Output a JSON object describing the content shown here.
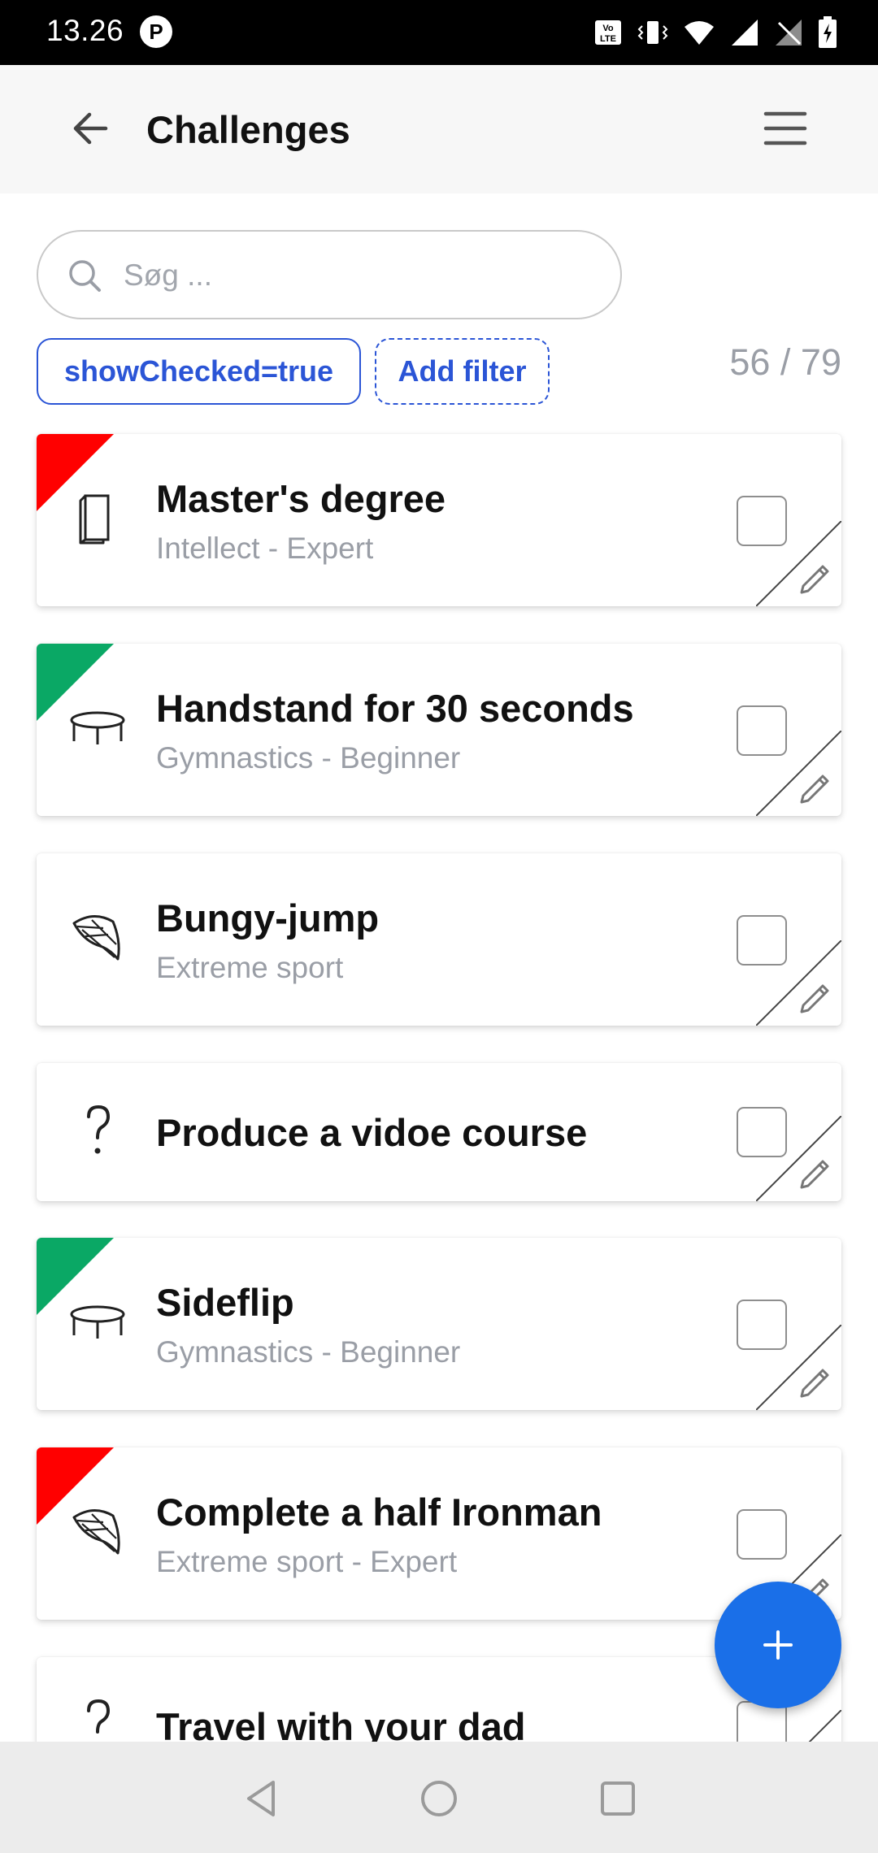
{
  "status_bar": {
    "time": "13.26",
    "app_indicator": "P",
    "icons": [
      "volte-icon",
      "vibrate-icon",
      "wifi-icon",
      "signal-icon",
      "no-signal-icon",
      "battery-charging-icon"
    ]
  },
  "app_bar": {
    "title": "Challenges",
    "back_icon": "arrow-left-icon",
    "menu_icon": "hamburger-menu-icon"
  },
  "search": {
    "placeholder": "Søg ...",
    "value": ""
  },
  "filters": {
    "active_filter": "showChecked=true",
    "add_filter_label": "Add filter",
    "count": "56 / 79"
  },
  "colors": {
    "accent": "#2b55d6",
    "fab": "#1a6fe8",
    "flag_red": "#ff0000",
    "flag_green": "#0aa865",
    "muted_text": "#9a9ea6"
  },
  "challenges": [
    {
      "title": "Master's degree",
      "subtitle": "Intellect - Expert",
      "icon": "book-icon",
      "flag": "red",
      "checked": false
    },
    {
      "title": "Handstand for 30 seconds",
      "subtitle": "Gymnastics - Beginner",
      "icon": "trampoline-icon",
      "flag": "green",
      "checked": false
    },
    {
      "title": "Bungy-jump",
      "subtitle": "Extreme sport",
      "icon": "parachute-icon",
      "flag": "none",
      "checked": false
    },
    {
      "title": "Produce a vidoe course",
      "subtitle": "",
      "icon": "question-icon",
      "flag": "none",
      "checked": false
    },
    {
      "title": "Sideflip",
      "subtitle": "Gymnastics - Beginner",
      "icon": "trampoline-icon",
      "flag": "green",
      "checked": false
    },
    {
      "title": "Complete a half Ironman",
      "subtitle": "Extreme sport - Expert",
      "icon": "parachute-icon",
      "flag": "red",
      "checked": false
    },
    {
      "title": "Travel with your dad",
      "subtitle": "",
      "icon": "question-icon",
      "flag": "none",
      "checked": false
    }
  ],
  "fab": {
    "label": "+",
    "icon": "plus-icon"
  },
  "nav_bar": {
    "buttons": [
      "back-triangle-icon",
      "home-circle-icon",
      "recents-square-icon"
    ]
  }
}
